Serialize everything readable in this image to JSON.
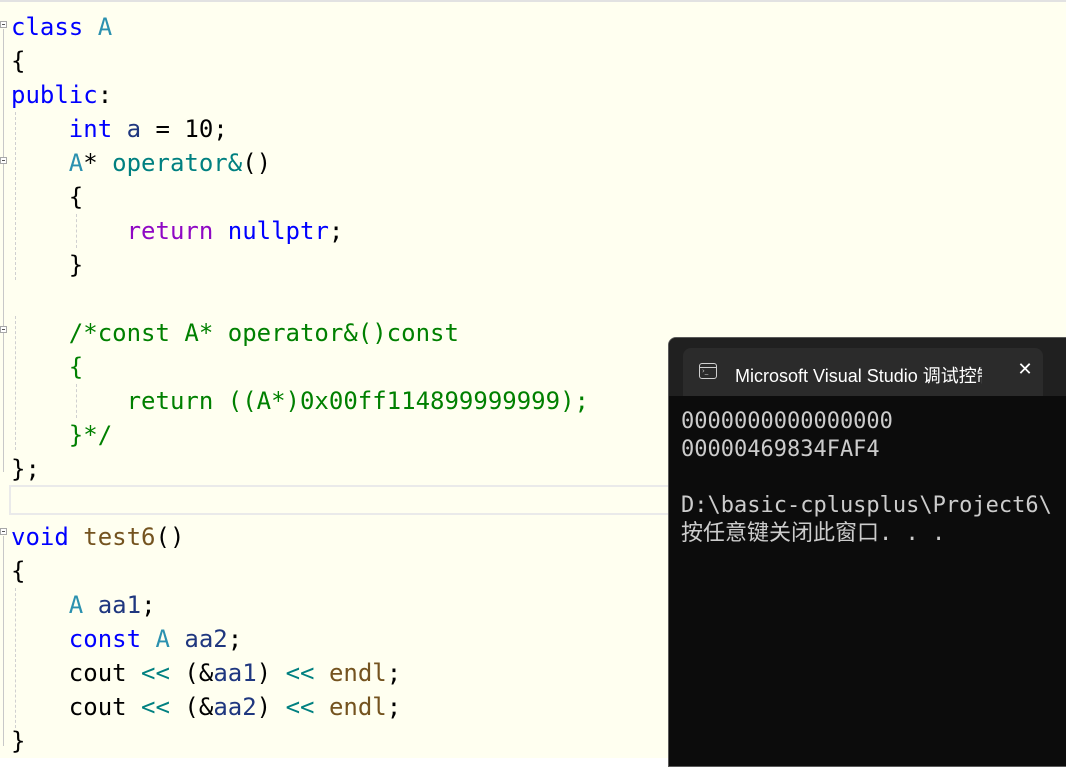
{
  "editor": {
    "lines": [
      [
        {
          "t": "class",
          "c": "k"
        },
        {
          "t": " "
        },
        {
          "t": "A",
          "c": "t"
        }
      ],
      [
        {
          "t": "{"
        }
      ],
      [
        {
          "t": "public",
          "c": "k"
        },
        {
          "t": ":"
        }
      ],
      [
        {
          "t": "    "
        },
        {
          "t": "int",
          "c": "k"
        },
        {
          "t": " "
        },
        {
          "t": "a",
          "c": "v"
        },
        {
          "t": " = 10;"
        }
      ],
      [
        {
          "t": "    "
        },
        {
          "t": "A",
          "c": "t"
        },
        {
          "t": "* "
        },
        {
          "t": "operator&",
          "c": "fo"
        },
        {
          "t": "()"
        }
      ],
      [
        {
          "t": "    {"
        }
      ],
      [
        {
          "t": "        "
        },
        {
          "t": "return",
          "c": "p"
        },
        {
          "t": " "
        },
        {
          "t": "nullptr",
          "c": "k"
        },
        {
          "t": ";"
        }
      ],
      [
        {
          "t": "    }"
        }
      ],
      [
        {
          "t": ""
        }
      ],
      [
        {
          "t": "    "
        },
        {
          "t": "/*const A* operator&()const",
          "c": "c"
        }
      ],
      [
        {
          "t": "    {",
          "c": "c"
        }
      ],
      [
        {
          "t": "        return ((A*)0x00ff114899999999);",
          "c": "c"
        }
      ],
      [
        {
          "t": "    }*/",
          "c": "c"
        }
      ],
      [
        {
          "t": "};"
        }
      ],
      [
        {
          "t": ""
        }
      ],
      [
        {
          "t": "void",
          "c": "k"
        },
        {
          "t": " "
        },
        {
          "t": "test6",
          "c": "f"
        },
        {
          "t": "()"
        }
      ],
      [
        {
          "t": "{"
        }
      ],
      [
        {
          "t": "    "
        },
        {
          "t": "A",
          "c": "t"
        },
        {
          "t": " "
        },
        {
          "t": "aa1",
          "c": "v"
        },
        {
          "t": ";"
        }
      ],
      [
        {
          "t": "    "
        },
        {
          "t": "const",
          "c": "k"
        },
        {
          "t": " "
        },
        {
          "t": "A",
          "c": "t"
        },
        {
          "t": " "
        },
        {
          "t": "aa2",
          "c": "v"
        },
        {
          "t": ";"
        }
      ],
      [
        {
          "t": "    cout "
        },
        {
          "t": "<<",
          "c": "o"
        },
        {
          "t": " (&"
        },
        {
          "t": "aa1",
          "c": "v"
        },
        {
          "t": ") "
        },
        {
          "t": "<<",
          "c": "o"
        },
        {
          "t": " "
        },
        {
          "t": "endl",
          "c": "f"
        },
        {
          "t": ";"
        }
      ],
      [
        {
          "t": "    cout "
        },
        {
          "t": "<<",
          "c": "o"
        },
        {
          "t": " (&"
        },
        {
          "t": "aa2",
          "c": "v"
        },
        {
          "t": ") "
        },
        {
          "t": "<<",
          "c": "o"
        },
        {
          "t": " "
        },
        {
          "t": "endl",
          "c": "f"
        },
        {
          "t": ";"
        }
      ],
      [
        {
          "t": "}"
        }
      ]
    ]
  },
  "console": {
    "title": "Microsoft Visual Studio 调试控制台",
    "close_icon": "close-icon",
    "app_icon": "terminal-icon",
    "output": "0000000000000000\n00000469834FAF4\n\nD:\\basic-cplusplus\\Project6\\\n按任意键关闭此窗口. . ."
  },
  "colors": {
    "editor_bg": "#fffff0",
    "keyword": "#0000ff",
    "type": "#2b91af",
    "function": "#74531f",
    "comment": "#008000",
    "control": "#8f08c4",
    "variable": "#1f377f",
    "console_bg": "#0c0c0c",
    "console_text": "#cccccc"
  }
}
